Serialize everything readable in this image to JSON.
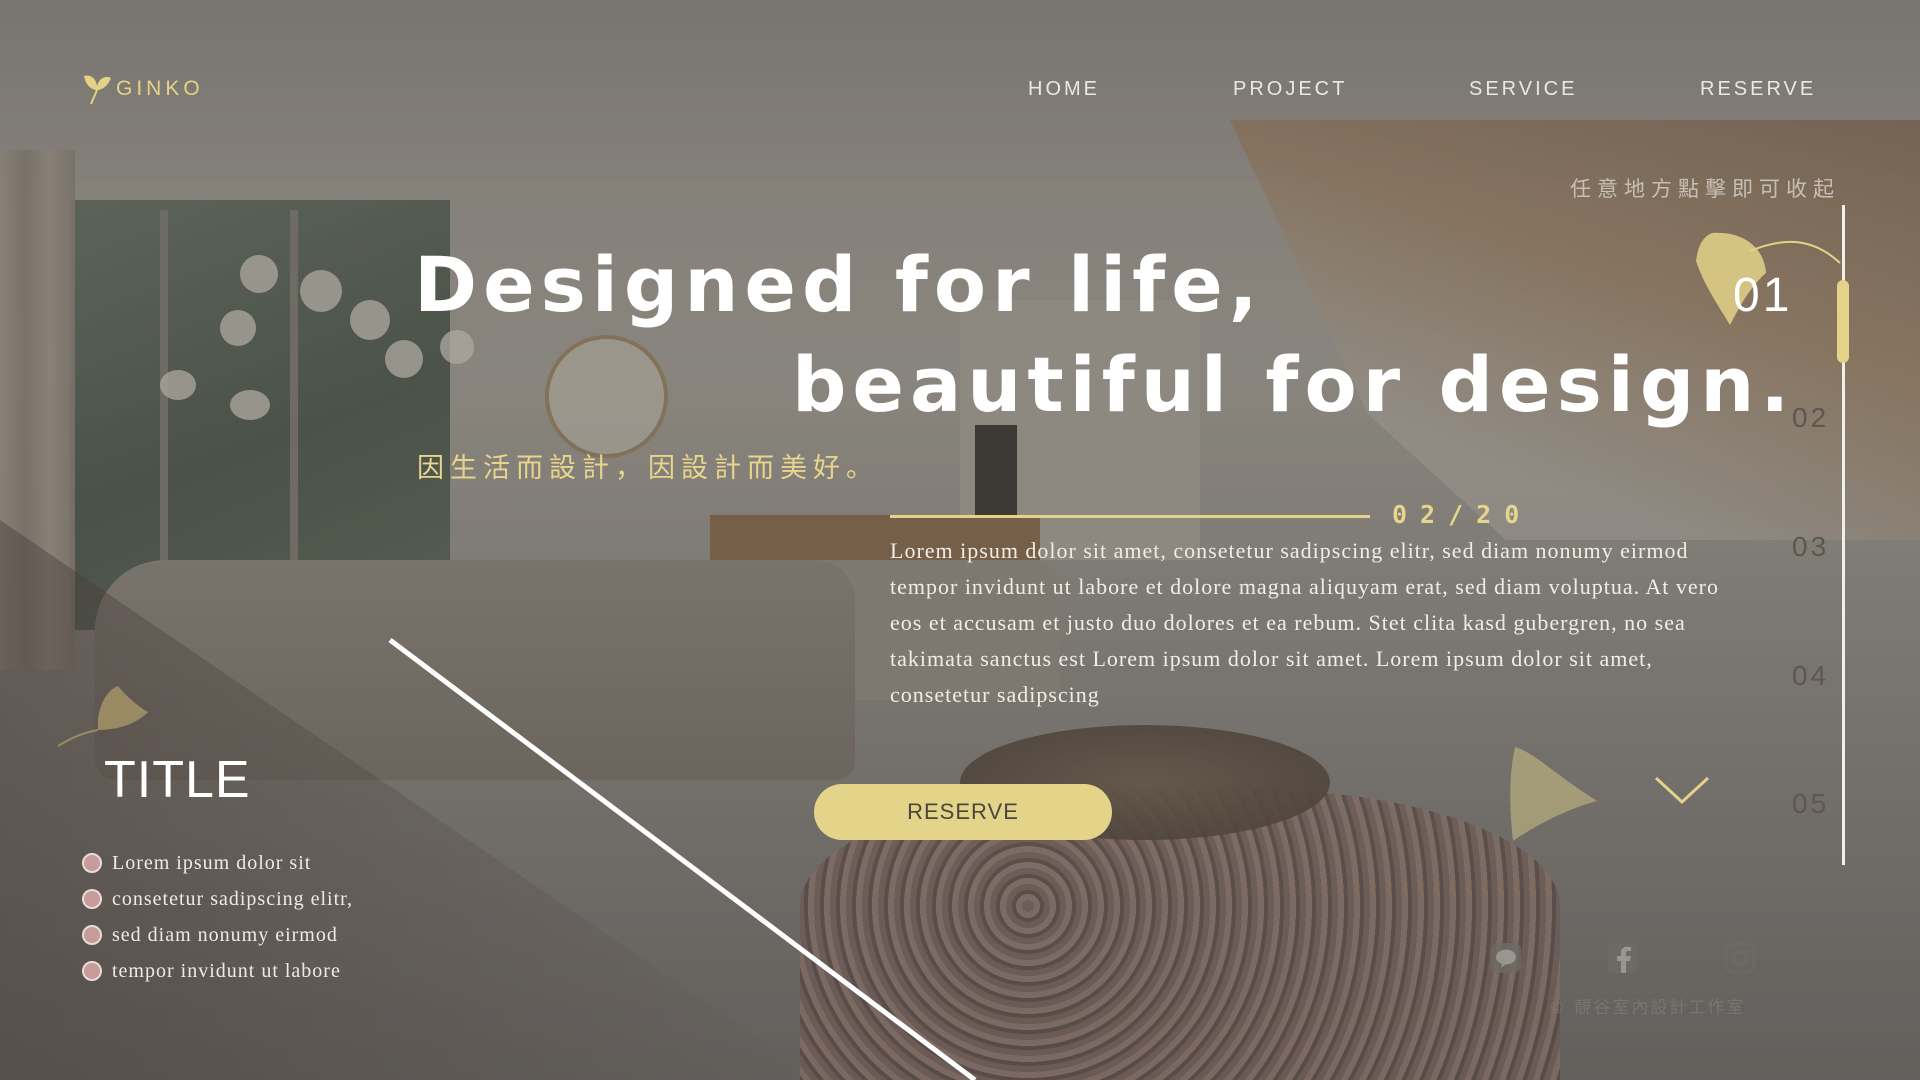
{
  "brand": {
    "name": "GINKO",
    "accent_color": "#e3d287"
  },
  "nav": {
    "items": [
      "HOME",
      "PROJECT",
      "SERVICE",
      "RESERVE"
    ]
  },
  "collapse_hint": "任意地方點擊即可收起",
  "hero": {
    "headline_line1": "Designed for life,",
    "headline_line2": "beautiful for design.",
    "subtitle": "因生活而設計，因設計而美好。",
    "date": "02/20",
    "body": "Lorem ipsum dolor sit amet, consetetur sadipscing elitr, sed diam nonumy eirmod tempor invidunt ut labore et dolore magna aliquyam erat, sed diam voluptua. At vero eos et accusam et justo duo dolores et ea rebum. Stet clita kasd gubergren, no sea takimata sanctus est Lorem ipsum dolor sit amet. Lorem ipsum dolor sit amet, consetetur sadipscing",
    "reserve_label": "RESERVE"
  },
  "card": {
    "title": "TITLE",
    "bullets": [
      "Lorem ipsum dolor sit",
      "consetetur sadipscing elitr,",
      "sed diam nonumy eirmod",
      "tempor invidunt ut labore"
    ]
  },
  "slider": {
    "items": [
      "01",
      "02",
      "03",
      "04",
      "05"
    ],
    "active": "01"
  },
  "social": {
    "icons": [
      "line-icon",
      "facebook-icon",
      "instagram-icon"
    ]
  },
  "copyright": "© 靚谷室內設計工作室"
}
